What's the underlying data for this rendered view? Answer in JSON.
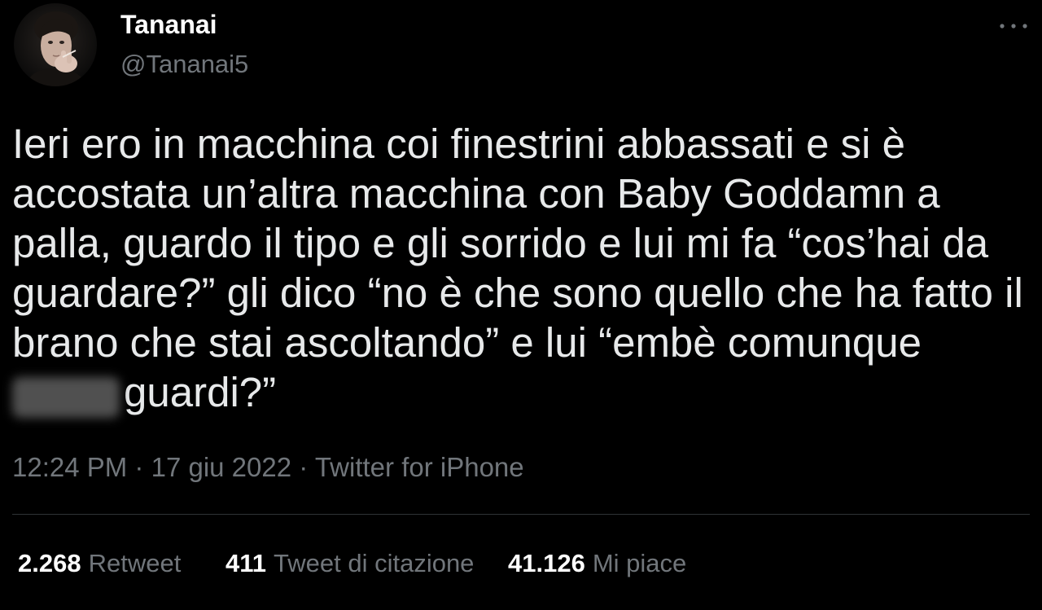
{
  "tweet": {
    "author": {
      "name": "Tananai",
      "handle": "@Tananai5"
    },
    "text_lines": [
      "Ieri ero in macchina coi finestrini abbassati e si è",
      "accostata un’altra macchina con Baby Goddamn a",
      "palla, guardo il tipo e gli sorrido e lui mi fa “cos’hai da",
      "guardare?” gli dico “no è che sono quello che ha fatto il",
      "brano che stai ascoltando” e lui “embè comunque",
      "guardi?”"
    ],
    "meta": {
      "time": "12:24 PM",
      "separator": "·",
      "date": "17 giu 2022",
      "source": "Twitter for iPhone"
    },
    "stats": [
      {
        "count": "2.268",
        "label": "Retweet"
      },
      {
        "count": "411",
        "label": "Tweet di citazione"
      },
      {
        "count": "41.126",
        "label": "Mi piace"
      }
    ]
  },
  "icons": {
    "avatar": "profile-photo",
    "more": "more-options-icon"
  },
  "colors": {
    "background": "#000000",
    "text": "#e7e9ea",
    "name": "#ffffff",
    "secondary": "#71767b",
    "divider": "#2f3336",
    "blur": "#505050"
  }
}
